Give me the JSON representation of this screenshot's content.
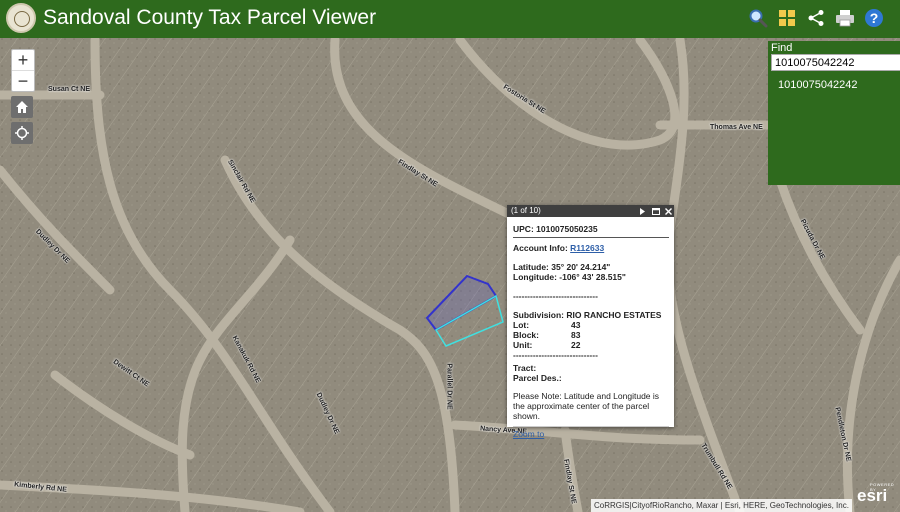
{
  "header": {
    "title": "Sandoval County Tax Parcel Viewer",
    "bg_color": "#2e6a1d",
    "tools": [
      "search-icon",
      "grid-icon",
      "share-icon",
      "print-icon",
      "help-icon"
    ]
  },
  "find": {
    "label": "Find",
    "value": "1010075042242",
    "result": "1010075042242"
  },
  "popup": {
    "counter": "(1 of 10)",
    "upc": "UPC: 1010075050235",
    "account_label": "Account Info:",
    "account_link": "R112633",
    "latitude": "Latitude: 35° 20' 24.214\"",
    "longitude": "Longitude: -106° 43' 28.515\"",
    "divider": "------------------------------",
    "subdivision": "Subdivision: RIO RANCHO ESTATES",
    "lot_label": "Lot:",
    "lot_value": "43",
    "block_label": "Block:",
    "block_value": "83",
    "unit_label": "Unit:",
    "unit_value": "22",
    "tract": "Tract:",
    "parcel_des": "Parcel Des.:",
    "note": "Please Note: Latitude and Longitude is the approximate center of the parcel shown.",
    "zoom_link": "Zoom to"
  },
  "map": {
    "streets": [
      "Susan Ct NE",
      "Fostoria St NE",
      "Thomas Ave NE",
      "Findlay St NE",
      "Sinclair Rd NE",
      "Picuda Dr NE",
      "Dudley Dr NE",
      "Kanakuk Rd NE",
      "Dudley Dr NE",
      "Dewitt Ct NE",
      "Parallel Dr NE",
      "Nancy Ave NE",
      "Kimberly Rd NE",
      "Findlay St NE",
      "Trumbull Rd NE",
      "Pendleton Dr NE"
    ],
    "attribution": "CoRRGIS|CityofRioRancho, Maxar | Esri, HERE, GeoTechnologies, Inc.",
    "esri_small": "POWERED BY",
    "esri": "esri",
    "selected_color": "#3333cc",
    "highlight_color": "#40e0e0"
  }
}
